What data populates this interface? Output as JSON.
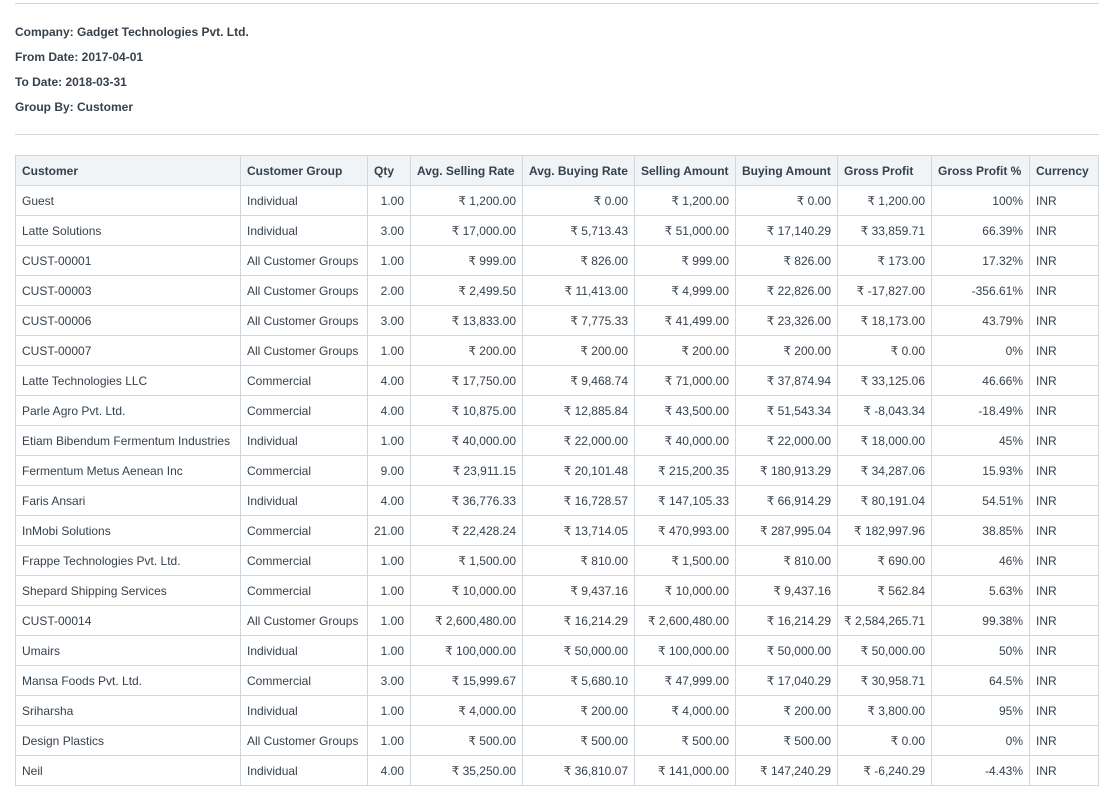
{
  "filters": {
    "company": "Company: Gadget Technologies Pvt. Ltd.",
    "from_date": "From Date: 2017-04-01",
    "to_date": "To Date: 2018-03-31",
    "group_by": "Group By: Customer"
  },
  "table": {
    "columns": [
      "Customer",
      "Customer Group",
      "Qty",
      "Avg. Selling Rate",
      "Avg. Buying Rate",
      "Selling Amount",
      "Buying Amount",
      "Gross Profit",
      "Gross Profit %",
      "Currency"
    ],
    "rows": [
      [
        "Guest",
        "Individual",
        "1.00",
        "₹ 1,200.00",
        "₹ 0.00",
        "₹ 1,200.00",
        "₹ 0.00",
        "₹ 1,200.00",
        "100%",
        "INR"
      ],
      [
        "Latte Solutions",
        "Individual",
        "3.00",
        "₹ 17,000.00",
        "₹ 5,713.43",
        "₹ 51,000.00",
        "₹ 17,140.29",
        "₹ 33,859.71",
        "66.39%",
        "INR"
      ],
      [
        "CUST-00001",
        "All Customer Groups",
        "1.00",
        "₹ 999.00",
        "₹ 826.00",
        "₹ 999.00",
        "₹ 826.00",
        "₹ 173.00",
        "17.32%",
        "INR"
      ],
      [
        "CUST-00003",
        "All Customer Groups",
        "2.00",
        "₹ 2,499.50",
        "₹ 11,413.00",
        "₹ 4,999.00",
        "₹ 22,826.00",
        "₹ -17,827.00",
        "-356.61%",
        "INR"
      ],
      [
        "CUST-00006",
        "All Customer Groups",
        "3.00",
        "₹ 13,833.00",
        "₹ 7,775.33",
        "₹ 41,499.00",
        "₹ 23,326.00",
        "₹ 18,173.00",
        "43.79%",
        "INR"
      ],
      [
        "CUST-00007",
        "All Customer Groups",
        "1.00",
        "₹ 200.00",
        "₹ 200.00",
        "₹ 200.00",
        "₹ 200.00",
        "₹ 0.00",
        "0%",
        "INR"
      ],
      [
        "Latte Technologies LLC",
        "Commercial",
        "4.00",
        "₹ 17,750.00",
        "₹ 9,468.74",
        "₹ 71,000.00",
        "₹ 37,874.94",
        "₹ 33,125.06",
        "46.66%",
        "INR"
      ],
      [
        "Parle Agro Pvt. Ltd.",
        "Commercial",
        "4.00",
        "₹ 10,875.00",
        "₹ 12,885.84",
        "₹ 43,500.00",
        "₹ 51,543.34",
        "₹ -8,043.34",
        "-18.49%",
        "INR"
      ],
      [
        "Etiam Bibendum Fermentum Industries",
        "Individual",
        "1.00",
        "₹ 40,000.00",
        "₹ 22,000.00",
        "₹ 40,000.00",
        "₹ 22,000.00",
        "₹ 18,000.00",
        "45%",
        "INR"
      ],
      [
        "Fermentum Metus Aenean Inc",
        "Commercial",
        "9.00",
        "₹ 23,911.15",
        "₹ 20,101.48",
        "₹ 215,200.35",
        "₹ 180,913.29",
        "₹ 34,287.06",
        "15.93%",
        "INR"
      ],
      [
        "Faris Ansari",
        "Individual",
        "4.00",
        "₹ 36,776.33",
        "₹ 16,728.57",
        "₹ 147,105.33",
        "₹ 66,914.29",
        "₹ 80,191.04",
        "54.51%",
        "INR"
      ],
      [
        "InMobi Solutions",
        "Commercial",
        "21.00",
        "₹ 22,428.24",
        "₹ 13,714.05",
        "₹ 470,993.00",
        "₹ 287,995.04",
        "₹ 182,997.96",
        "38.85%",
        "INR"
      ],
      [
        "Frappe Technologies Pvt. Ltd.",
        "Commercial",
        "1.00",
        "₹ 1,500.00",
        "₹ 810.00",
        "₹ 1,500.00",
        "₹ 810.00",
        "₹ 690.00",
        "46%",
        "INR"
      ],
      [
        "Shepard Shipping Services",
        "Commercial",
        "1.00",
        "₹ 10,000.00",
        "₹ 9,437.16",
        "₹ 10,000.00",
        "₹ 9,437.16",
        "₹ 562.84",
        "5.63%",
        "INR"
      ],
      [
        "CUST-00014",
        "All Customer Groups",
        "1.00",
        "₹ 2,600,480.00",
        "₹ 16,214.29",
        "₹ 2,600,480.00",
        "₹ 16,214.29",
        "₹ 2,584,265.71",
        "99.38%",
        "INR"
      ],
      [
        "Umairs",
        "Individual",
        "1.00",
        "₹ 100,000.00",
        "₹ 50,000.00",
        "₹ 100,000.00",
        "₹ 50,000.00",
        "₹ 50,000.00",
        "50%",
        "INR"
      ],
      [
        "Mansa Foods Pvt. Ltd.",
        "Commercial",
        "3.00",
        "₹ 15,999.67",
        "₹ 5,680.10",
        "₹ 47,999.00",
        "₹ 17,040.29",
        "₹ 30,958.71",
        "64.5%",
        "INR"
      ],
      [
        "Sriharsha",
        "Individual",
        "1.00",
        "₹ 4,000.00",
        "₹ 200.00",
        "₹ 4,000.00",
        "₹ 200.00",
        "₹ 3,800.00",
        "95%",
        "INR"
      ],
      [
        "Design Plastics",
        "All Customer Groups",
        "1.00",
        "₹ 500.00",
        "₹ 500.00",
        "₹ 500.00",
        "₹ 500.00",
        "₹ 0.00",
        "0%",
        "INR"
      ],
      [
        "Neil",
        "Individual",
        "4.00",
        "₹ 35,250.00",
        "₹ 36,810.07",
        "₹ 141,000.00",
        "₹ 147,240.29",
        "₹ -6,240.29",
        "-4.43%",
        "INR"
      ]
    ]
  }
}
